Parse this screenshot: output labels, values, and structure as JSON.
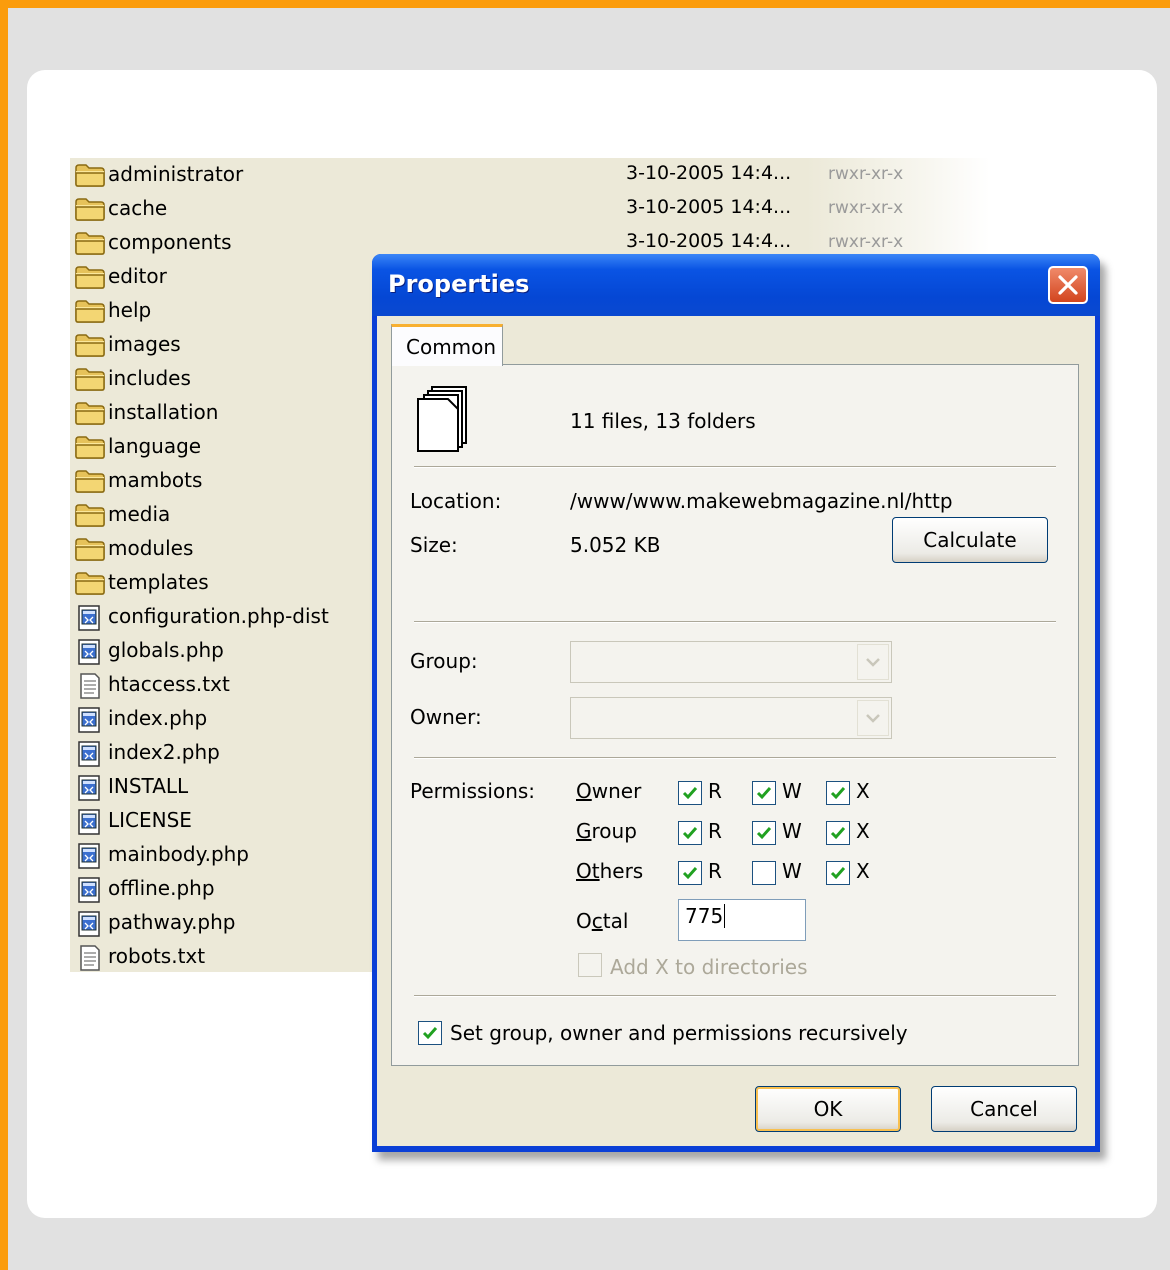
{
  "files": [
    {
      "name": "administrator",
      "type": "folder",
      "date": "3-10-2005 14:4...",
      "perm": "rwxr-xr-x"
    },
    {
      "name": "cache",
      "type": "folder",
      "date": "3-10-2005 14:4...",
      "perm": "rwxr-xr-x"
    },
    {
      "name": "components",
      "type": "folder",
      "date": "3-10-2005 14:4...",
      "perm": "rwxr-xr-x"
    },
    {
      "name": "editor",
      "type": "folder"
    },
    {
      "name": "help",
      "type": "folder"
    },
    {
      "name": "images",
      "type": "folder"
    },
    {
      "name": "includes",
      "type": "folder"
    },
    {
      "name": "installation",
      "type": "folder"
    },
    {
      "name": "language",
      "type": "folder"
    },
    {
      "name": "mambots",
      "type": "folder"
    },
    {
      "name": "media",
      "type": "folder"
    },
    {
      "name": "modules",
      "type": "folder"
    },
    {
      "name": "templates",
      "type": "folder"
    },
    {
      "name": "configuration.php-dist",
      "type": "file-php"
    },
    {
      "name": "globals.php",
      "type": "file-php"
    },
    {
      "name": "htaccess.txt",
      "type": "file-txt"
    },
    {
      "name": "index.php",
      "type": "file-php"
    },
    {
      "name": "index2.php",
      "type": "file-php"
    },
    {
      "name": "INSTALL",
      "type": "file-php"
    },
    {
      "name": "LICENSE",
      "type": "file-php"
    },
    {
      "name": "mainbody.php",
      "type": "file-php"
    },
    {
      "name": "offline.php",
      "type": "file-php"
    },
    {
      "name": "pathway.php",
      "type": "file-php"
    },
    {
      "name": "robots.txt",
      "type": "file-txt"
    }
  ],
  "dialog": {
    "title": "Properties",
    "tab": "Common",
    "summary": "11 files, 13 folders",
    "location_label": "Location:",
    "location_value": "/www/www.makewebmagazine.nl/http",
    "size_label": "Size:",
    "size_value": "5.052 KB",
    "calculate_label": "Calculate",
    "group_label": "Group:",
    "owner_label": "Owner:",
    "permissions_label": "Permissions:",
    "perm_rows": [
      {
        "access": "O",
        "rest": "wner",
        "r": true,
        "w": true,
        "x": true
      },
      {
        "access": "G",
        "rest": "roup",
        "r": true,
        "w": true,
        "x": true
      },
      {
        "access": "Ot",
        "rest": "hers",
        "r": true,
        "w": false,
        "x": true
      }
    ],
    "r_label": "R",
    "w_label": "W",
    "x_label": "X",
    "octal_label_first": "O",
    "octal_label_u": "c",
    "octal_label_rest": "tal",
    "octal_value": "775",
    "add_x_label": "Add X to directories",
    "recursive_label": "Set group, owner and permissions recursively",
    "ok_label": "OK",
    "cancel_label": "Cancel"
  },
  "colors": {
    "accent_border": "#fb9c0c",
    "title_bar": "#0a54e4",
    "close_button": "#d2451e"
  }
}
